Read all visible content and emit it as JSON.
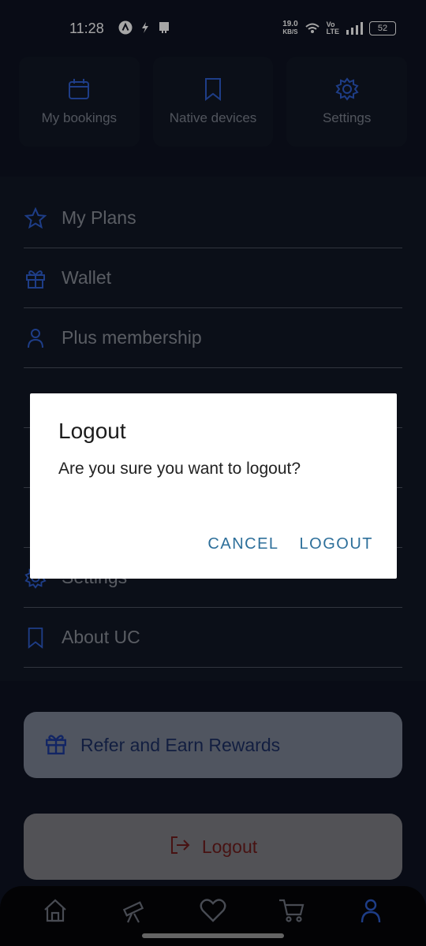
{
  "status_bar": {
    "time": "11:28",
    "speed_value": "19.0",
    "speed_unit": "KB/S",
    "volte_top": "Vo",
    "volte_bottom": "LTE",
    "battery": "52"
  },
  "tiles": [
    {
      "label": "My bookings",
      "icon": "calendar-icon"
    },
    {
      "label": "Native devices",
      "icon": "bookmark-icon"
    },
    {
      "label": "Settings",
      "icon": "gear-icon"
    }
  ],
  "menu": [
    {
      "label": "My Plans",
      "icon": "star-icon"
    },
    {
      "label": "Wallet",
      "icon": "gift-icon"
    },
    {
      "label": "Plus membership",
      "icon": "user-icon"
    },
    {
      "label": "Settings",
      "icon": "gear-icon"
    },
    {
      "label": "About UC",
      "icon": "bookmark-icon"
    }
  ],
  "refer_button": {
    "label": "Refer and Earn Rewards",
    "icon": "gift-icon"
  },
  "logout_button": {
    "label": "Logout",
    "icon": "logout-icon"
  },
  "bottom_nav": [
    "home-icon",
    "telescope-icon",
    "heart-icon",
    "cart-icon",
    "user-icon"
  ],
  "dialog": {
    "title": "Logout",
    "message": "Are you sure you want to logout?",
    "cancel": "CANCEL",
    "confirm": "LOGOUT"
  },
  "colors": {
    "accent": "#2f5fd0",
    "dialog_button": "#2d6f9a",
    "logout_red": "#6e1c1c"
  }
}
